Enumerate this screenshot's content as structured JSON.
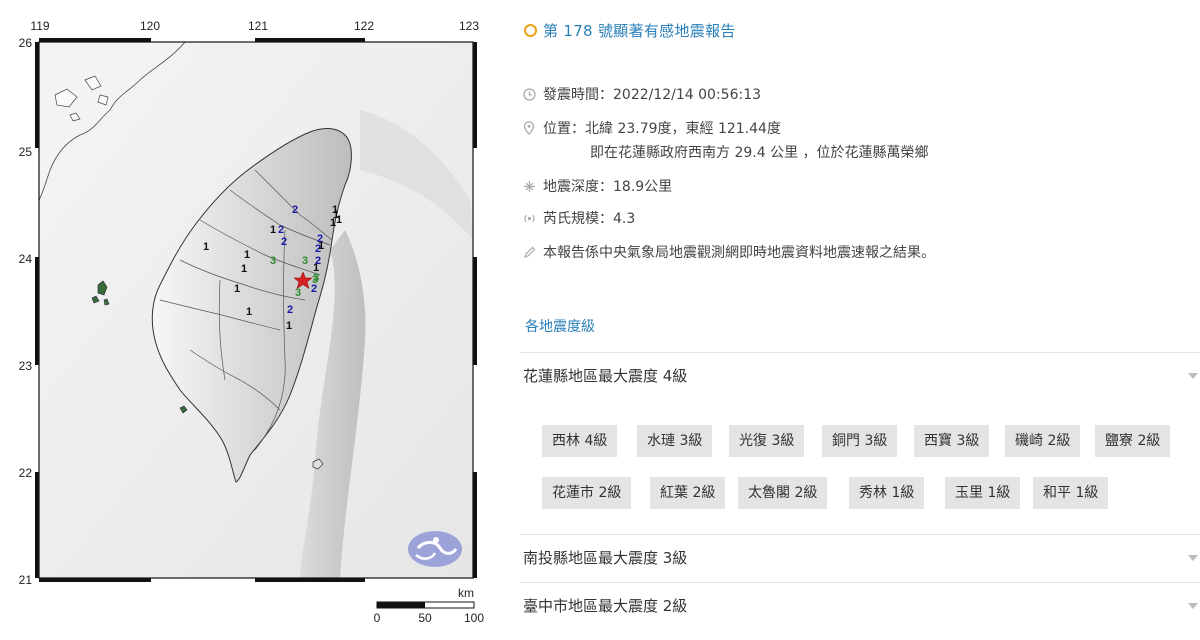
{
  "map": {
    "lon_ticks": [
      "119",
      "120",
      "121",
      "122",
      "123"
    ],
    "lat_ticks": [
      "26",
      "25",
      "24",
      "23",
      "22",
      "21"
    ],
    "epicenter_symbol": "red-star",
    "logo": "cwb-logo",
    "scale": {
      "unit": "km",
      "labels": [
        "0",
        "50",
        "100"
      ]
    },
    "intensity_markers": [
      {
        "v": "2",
        "color": "#1a1aa8"
      },
      {
        "v": "1",
        "color": "#111111"
      },
      {
        "v": "1",
        "color": "#111111"
      },
      {
        "v": "1",
        "color": "#111111"
      },
      {
        "v": "2",
        "color": "#1a1aa8"
      },
      {
        "v": "2",
        "color": "#1a1aa8"
      },
      {
        "v": "2",
        "color": "#1a1aa8"
      },
      {
        "v": "1",
        "color": "#111111"
      },
      {
        "v": "1",
        "color": "#111111"
      },
      {
        "v": "2",
        "color": "#1a1aa8"
      },
      {
        "v": "1",
        "color": "#111111"
      },
      {
        "v": "3",
        "color": "#2e8b2e"
      },
      {
        "v": "3",
        "color": "#2e8b2e"
      },
      {
        "v": "1",
        "color": "#111111"
      },
      {
        "v": "3",
        "color": "#2e8b2e"
      },
      {
        "v": "2",
        "color": "#1a1aa8"
      },
      {
        "v": "1",
        "color": "#111111"
      },
      {
        "v": "3",
        "color": "#2e8b2e"
      },
      {
        "v": "3",
        "color": "#2e8b2e"
      },
      {
        "v": "2",
        "color": "#1a1aa8"
      },
      {
        "v": "1",
        "color": "#111111"
      },
      {
        "v": "1",
        "color": "#111111"
      },
      {
        "v": "2",
        "color": "#1a1aa8"
      },
      {
        "v": "1",
        "color": "#111111"
      },
      {
        "v": "1",
        "color": "#111111"
      },
      {
        "v": "1",
        "color": "#111111"
      }
    ]
  },
  "report": {
    "title": "第 178 號顯著有感地震報告",
    "origin_time": "發震時間：2022/12/14 00:56:13",
    "location": "位置：北緯 23.79度，東經 121.44度",
    "location_detail": "即在花蓮縣政府西南方 29.4 公里 ，位於花蓮縣萬榮鄉",
    "depth": "地震深度：18.9公里",
    "magnitude": "芮氏規模：4.3",
    "note": "本報告係中央氣象局地震觀測網即時地震資料地震速報之結果。",
    "section_label": "各地震度級",
    "regions": [
      {
        "label": "花蓮縣地區最大震度 4級",
        "stations": [
          "西林 4級",
          "水璉 3級",
          "光復 3級",
          "銅門 3級",
          "西寶 3級",
          "磯崎 2級",
          "鹽寮 2級",
          "花蓮市 2級",
          "紅葉 2級",
          "太魯閣 2級",
          "秀林 1級",
          "玉里 1級",
          "和平 1級"
        ]
      },
      {
        "label": "南投縣地區最大震度 3級"
      },
      {
        "label": "臺中市地區最大震度 2級"
      }
    ]
  },
  "colors": {
    "accent": "#2a7fb8",
    "title_dot": "#e8a317",
    "chip_bg": "#e4e4e4",
    "epicenter": "#d42020"
  }
}
